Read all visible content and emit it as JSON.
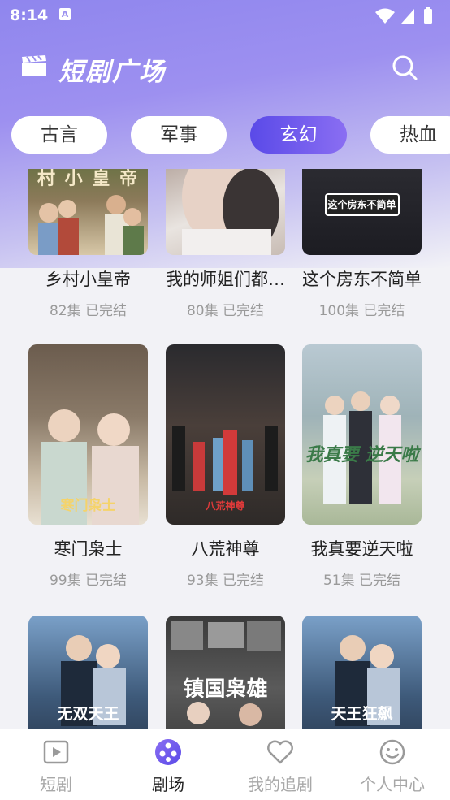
{
  "status": {
    "time": "8:14",
    "notif_letter": "A"
  },
  "header": {
    "title": "短剧广场"
  },
  "tabs": [
    {
      "label": "古言",
      "active": false
    },
    {
      "label": "军事",
      "active": false
    },
    {
      "label": "玄幻",
      "active": true
    },
    {
      "label": "热血",
      "active": false
    }
  ],
  "dramas": [
    {
      "title": "乡村小皇帝",
      "episodes": "82集",
      "status": "已完结",
      "poster_text": "村 小 皇 帝"
    },
    {
      "title": "我的师姐们都…",
      "episodes": "80集",
      "status": "已完结",
      "poster_text": ""
    },
    {
      "title": "这个房东不简单",
      "episodes": "100集",
      "status": "已完结",
      "poster_text": "这个房东不简单"
    },
    {
      "title": "寒门枭士",
      "episodes": "99集",
      "status": "已完结",
      "poster_text": "寒门枭士"
    },
    {
      "title": "八荒神尊",
      "episodes": "93集",
      "status": "已完结",
      "poster_text": "八荒神尊"
    },
    {
      "title": "我真要逆天啦",
      "episodes": "51集",
      "status": "已完结",
      "poster_text": "我真要 逆天啦"
    },
    {
      "title": "",
      "episodes": "",
      "status": "",
      "poster_text": "无双天王"
    },
    {
      "title": "",
      "episodes": "",
      "status": "",
      "poster_text": "镇国枭雄"
    },
    {
      "title": "",
      "episodes": "",
      "status": "",
      "poster_text": "天王狂飙"
    }
  ],
  "nav": [
    {
      "label": "短剧",
      "icon": "play-square-icon",
      "active": false
    },
    {
      "label": "剧场",
      "icon": "theater-reel-icon",
      "active": true
    },
    {
      "label": "我的追剧",
      "icon": "heart-icon",
      "active": false
    },
    {
      "label": "个人中心",
      "icon": "smiley-icon",
      "active": false
    }
  ],
  "colors": {
    "accent": "#5a4ae8",
    "header_top": "#8f86ee"
  }
}
